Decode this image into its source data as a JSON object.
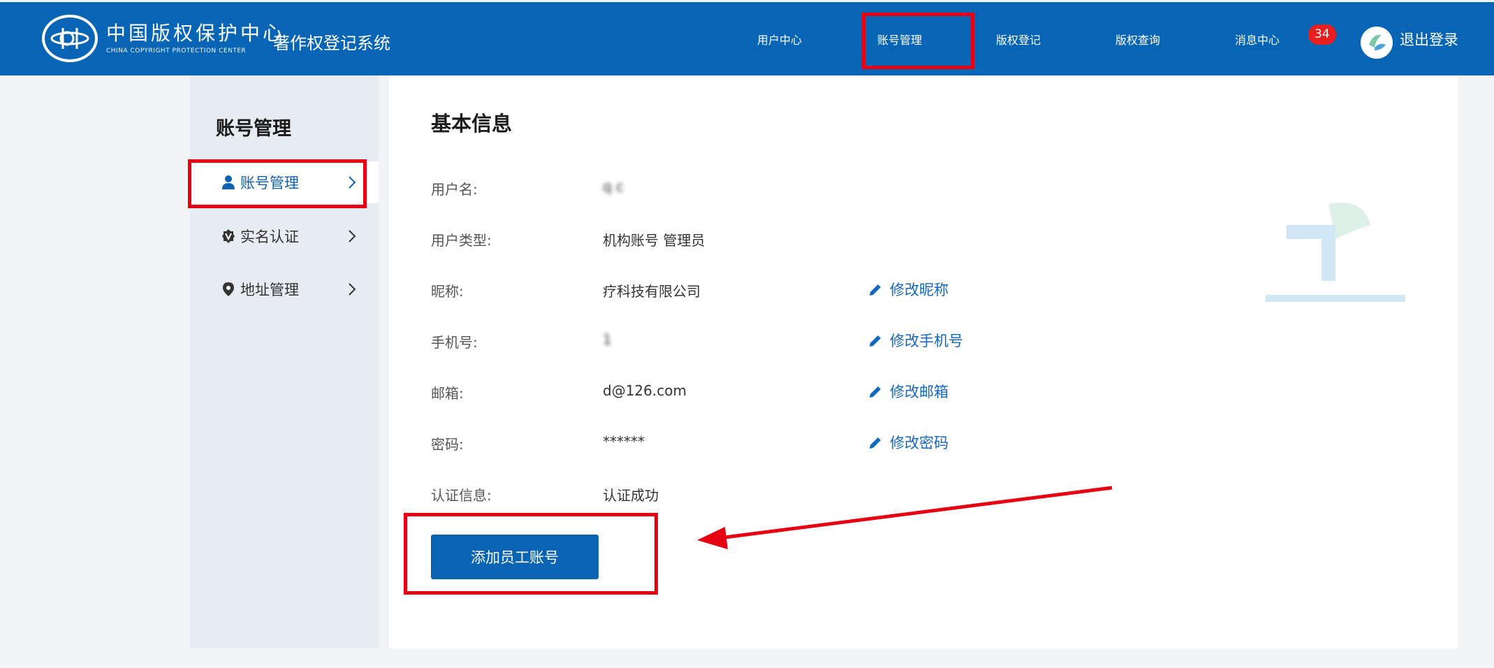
{
  "header": {
    "logo_cn": "中国版权保护中心",
    "logo_en": "CHINA COPYRIGHT PROTECTION CENTER",
    "system_title": "著作权登记系统",
    "nav": [
      {
        "label": "用户中心"
      },
      {
        "label": "账号管理"
      },
      {
        "label": "版权登记"
      },
      {
        "label": "版权查询"
      },
      {
        "label": "消息中心",
        "badge": "34"
      }
    ],
    "logout_label": "退出登录"
  },
  "sidebar": {
    "title": "账号管理",
    "items": [
      {
        "label": "账号管理",
        "icon": "user-icon"
      },
      {
        "label": "实名认证",
        "icon": "verified-badge-icon"
      },
      {
        "label": "地址管理",
        "icon": "location-pin-icon"
      }
    ]
  },
  "main": {
    "title": "基本信息",
    "rows": [
      {
        "label": "用户名:",
        "value": "q   c"
      },
      {
        "label": "用户类型:",
        "value": "机构账号 管理员"
      },
      {
        "label": "昵称:",
        "value": "         疗科技有限公司",
        "action": "修改昵称"
      },
      {
        "label": "手机号:",
        "value": "1     ",
        "action": "修改手机号"
      },
      {
        "label": "邮箱:",
        "value": "d@126.com",
        "action": "修改邮箱"
      },
      {
        "label": "密码:",
        "value": "******",
        "action": "修改密码"
      },
      {
        "label": "认证信息:",
        "value": "认证成功"
      }
    ],
    "add_button": "添加员工账号"
  },
  "colors": {
    "header_bg": "#0865b5",
    "sidebar_bg": "#e7ecf3",
    "accent": "#1367c1",
    "highlight_red": "#e60012",
    "badge_red": "#e81f1f"
  }
}
